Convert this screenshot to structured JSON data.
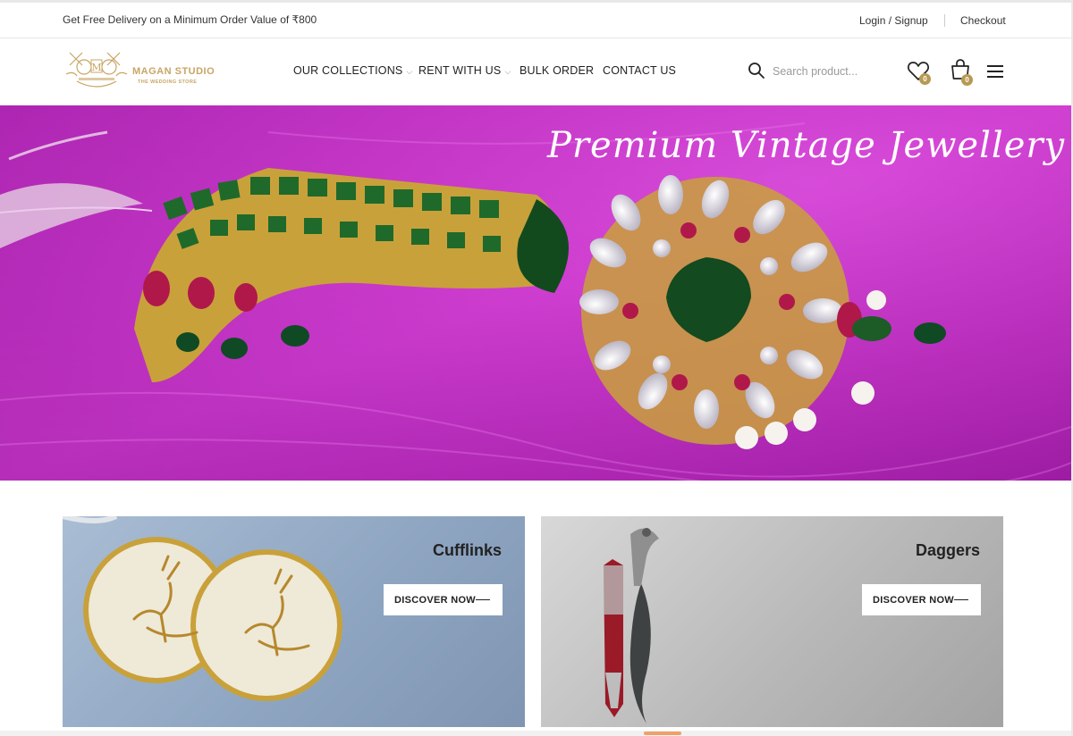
{
  "topbar": {
    "promo": "Get Free Delivery on a Minimum Order Value of ₹800",
    "login": "Login / Signup",
    "checkout": "Checkout"
  },
  "header": {
    "brand": "MAGAN STUDIO",
    "tagline": "THE WEDDING STORE",
    "nav": [
      {
        "label": "OUR COLLECTIONS",
        "has_dropdown": true
      },
      {
        "label": "RENT WITH US",
        "has_dropdown": true
      },
      {
        "label": "BULK ORDER",
        "has_dropdown": false
      },
      {
        "label": "CONTACT US",
        "has_dropdown": false
      }
    ],
    "search_placeholder": "Search product...",
    "wishlist_count": "0",
    "cart_count": "0",
    "icons": [
      "search-icon",
      "heart-icon",
      "shopping-bag-icon",
      "hamburger-menu-icon"
    ]
  },
  "hero": {
    "title": "Premium Vintage Jewellery"
  },
  "cards": [
    {
      "title": "Cufflinks",
      "button": "DISCOVER NOW"
    },
    {
      "title": "Daggers",
      "button": "DISCOVER NOW"
    }
  ],
  "colors": {
    "accent_gold": "#b79a52",
    "hero_magenta": "#c93ac9",
    "card_left_bg": "#8fa6c2",
    "card_right_bg": "#b9b9b9"
  }
}
